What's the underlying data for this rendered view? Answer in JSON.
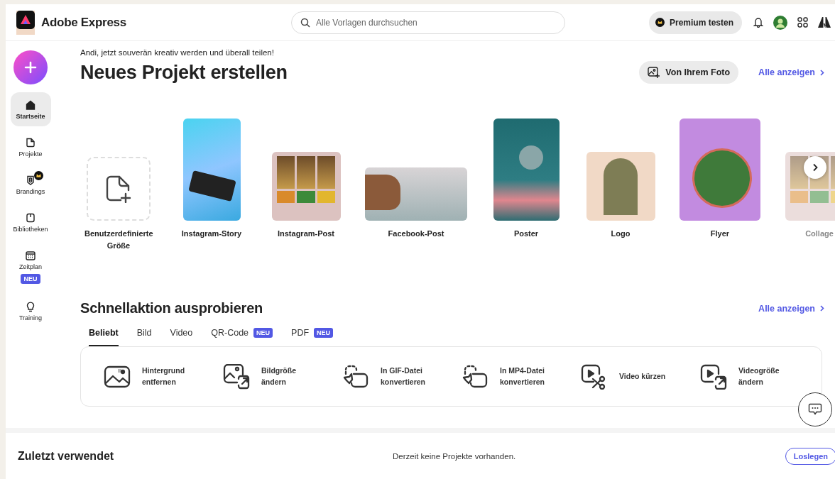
{
  "header": {
    "app_name": "Adobe Express",
    "search": {
      "placeholder": "Alle Vorlagen durchsuchen"
    },
    "premium_button": "Premium testen"
  },
  "sidebar": {
    "items": [
      {
        "label": "Startseite",
        "selected": true,
        "premium": false
      },
      {
        "label": "Projekte",
        "selected": false,
        "premium": false
      },
      {
        "label": "Brandings",
        "selected": false,
        "premium": true
      },
      {
        "label": "Bibliotheken",
        "selected": false,
        "premium": false
      },
      {
        "label": "Zeitplan",
        "selected": false,
        "premium": false,
        "badge": "NEU"
      },
      {
        "label": "Training",
        "selected": false,
        "premium": false
      }
    ]
  },
  "greeting": "Andi, jetzt souverän kreativ werden und überall teilen!",
  "new_project": {
    "title": "Neues Projekt erstellen",
    "photo_button": "Von Ihrem Foto",
    "see_all": "Alle anzeigen",
    "templates": [
      {
        "kind": "custom",
        "label": "Benutzerdefinierte Größe",
        "faded": false
      },
      {
        "kind": "story",
        "label": "Instagram-Story",
        "faded": false
      },
      {
        "kind": "post",
        "label": "Instagram-Post",
        "faded": false
      },
      {
        "kind": "wide",
        "label": "Facebook-Post",
        "faded": false
      },
      {
        "kind": "poster",
        "label": "Poster",
        "faded": false
      },
      {
        "kind": "logo",
        "label": "Logo",
        "faded": false
      },
      {
        "kind": "flyer",
        "label": "Flyer",
        "faded": false
      },
      {
        "kind": "collage",
        "label": "Collage",
        "faded": true
      }
    ]
  },
  "quick_actions": {
    "title": "Schnellaktion ausprobieren",
    "see_all": "Alle anzeigen",
    "tabs": [
      {
        "label": "Beliebt",
        "selected": true
      },
      {
        "label": "Bild",
        "selected": false
      },
      {
        "label": "Video",
        "selected": false
      },
      {
        "label": "QR-Code",
        "selected": false,
        "badge": "NEU"
      },
      {
        "label": "PDF",
        "selected": false,
        "badge": "NEU"
      }
    ],
    "actions": [
      {
        "lines": [
          "Hintergrund",
          "entfernen"
        ]
      },
      {
        "lines": [
          "Bildgröße",
          "ändern"
        ]
      },
      {
        "lines": [
          "In GIF-Datei",
          "konvertieren"
        ]
      },
      {
        "lines": [
          "In MP4-Datei",
          "konvertieren"
        ]
      },
      {
        "lines": [
          "Video kürzen"
        ]
      },
      {
        "lines": [
          "Videogröße",
          "ändern"
        ]
      }
    ]
  },
  "recent": {
    "title": "Zuletzt verwendet",
    "empty_text": "Derzeit keine Projekte vorhanden.",
    "button": "Loslegen"
  }
}
